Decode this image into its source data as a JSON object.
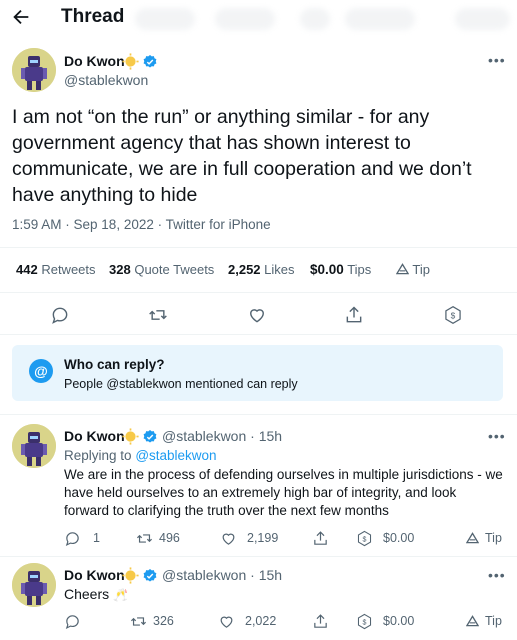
{
  "header": {
    "title": "Thread"
  },
  "tweet": {
    "author_name": "Do Kwon",
    "author_handle": "@stablekwon",
    "text": "I am not “on the run” or anything similar - for any government agency that has shown interest to communicate, we are in full cooperation and we don’t have anything to hide",
    "time": "1:59 AM",
    "date": "Sep 18, 2022",
    "source": "Twitter for iPhone",
    "meta_sep": " · ",
    "stats": {
      "retweets_count": "442",
      "retweets_label": "Retweets",
      "quotes_count": "328",
      "quotes_label": "Quote Tweets",
      "likes_count": "2,252",
      "likes_label": "Likes",
      "tips_amount": "$0.00",
      "tips_label": "Tips",
      "tip_label": "Tip"
    }
  },
  "who_can_reply": {
    "title": "Who can reply?",
    "description": "People @stablekwon mentioned can reply"
  },
  "replies": [
    {
      "author_name": "Do Kwon",
      "author_handle": "@stablekwon",
      "time_ago": "15h",
      "separator": "·",
      "replying_prefix": "Replying to",
      "replying_to": "@stablekwon",
      "text": "We are in the process of defending ourselves in multiple jurisdictions - we have held ourselves to an extremely high bar of integrity, and look forward to clarifying the truth over the next few months",
      "reply_count": "1",
      "retweet_count": "496",
      "like_count": "2,199",
      "tip_amount": "$0.00",
      "tip_label": "Tip"
    },
    {
      "author_name": "Do Kwon",
      "author_handle": "@stablekwon",
      "time_ago": "15h",
      "separator": "·",
      "text": "Cheers",
      "emoji": "🥂",
      "retweet_count": "326",
      "like_count": "2,022",
      "tip_amount": "$0.00",
      "tip_label": "Tip"
    }
  ],
  "colors": {
    "accent": "#1d9bf0",
    "text_primary": "#0f1419",
    "text_secondary": "#536471",
    "reply_box_bg": "#e8f5fd",
    "badge_gold": "#f5c518"
  },
  "icons": [
    "back-arrow-icon",
    "verified-icon",
    "sun-badge-icon",
    "more-icon",
    "reply-icon",
    "retweet-icon",
    "like-icon",
    "share-icon",
    "tip-dollar-icon",
    "tip-triangle-icon",
    "at-icon"
  ]
}
